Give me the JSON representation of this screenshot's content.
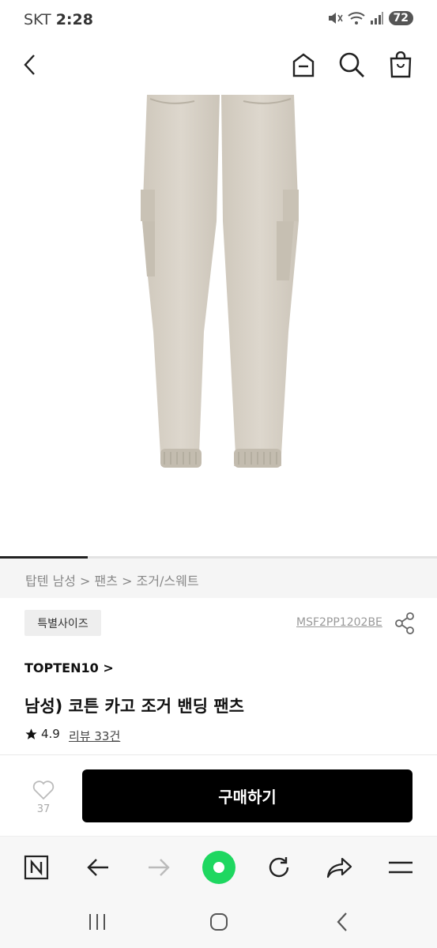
{
  "status_bar": {
    "carrier": "SKT",
    "time": "2:28",
    "battery": "72"
  },
  "header": {
    "back_icon": "chevron-left-icon",
    "home_icon": "home-icon",
    "search_icon": "search-icon",
    "cart_icon": "shopping-bag-icon"
  },
  "breadcrumb": "탑텐 남성 > 팬츠 > 조거/스웨트",
  "product": {
    "badge": "특별사이즈",
    "code": "MSF2PP1202BE",
    "brand": "TOPTEN10 >",
    "title": "남성) 코튼 카고 조거 밴딩 팬츠",
    "rating": "4.9",
    "reviews": "리뷰 33건",
    "likes": "37",
    "buy_label": "구매하기",
    "color": "#d8d2c8"
  },
  "browser_toolbar": [
    "naver-n-icon",
    "back-arrow-icon",
    "forward-arrow-icon",
    "green-dot-icon",
    "refresh-icon",
    "share-icon",
    "menu-icon"
  ],
  "android_nav": [
    "recents-icon",
    "home-icon",
    "back-icon"
  ],
  "colors": {
    "accent": "#1ed760",
    "buy_bg": "#000000"
  }
}
